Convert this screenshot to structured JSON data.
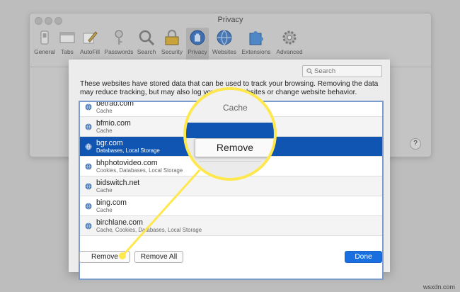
{
  "window": {
    "title": "Privacy"
  },
  "toolbar": {
    "items": [
      {
        "label": "General",
        "icon": "general-switch-icon"
      },
      {
        "label": "Tabs",
        "icon": "tabs-icon"
      },
      {
        "label": "AutoFill",
        "icon": "pencil-icon"
      },
      {
        "label": "Passwords",
        "icon": "key-icon"
      },
      {
        "label": "Search",
        "icon": "magnifier-icon"
      },
      {
        "label": "Security",
        "icon": "lock-icon"
      },
      {
        "label": "Privacy",
        "icon": "hand-icon"
      },
      {
        "label": "Websites",
        "icon": "globe-icon"
      },
      {
        "label": "Extensions",
        "icon": "puzzle-icon"
      },
      {
        "label": "Advanced",
        "icon": "gear-icon"
      }
    ],
    "active": "Privacy"
  },
  "help": {
    "label": "?"
  },
  "sheet": {
    "search_placeholder": "Search",
    "description": "These websites have stored data that can be used to track your browsing. Removing the data may reduce tracking, but may also log you out of websites or change website behavior.",
    "websites": [
      {
        "domain": "betrad.com",
        "data": "Cache"
      },
      {
        "domain": "bfmio.com",
        "data": "Cache"
      },
      {
        "domain": "bgr.com",
        "data": "Databases, Local Storage",
        "selected": true
      },
      {
        "domain": "bhphotovideo.com",
        "data": "Cookies, Databases, Local Storage"
      },
      {
        "domain": "bidswitch.net",
        "data": "Cache"
      },
      {
        "domain": "bing.com",
        "data": "Cache"
      },
      {
        "domain": "birchlane.com",
        "data": "Cache, Cookies, Databases, Local Storage"
      }
    ],
    "buttons": {
      "remove": "Remove",
      "remove_all": "Remove All",
      "done": "Done"
    }
  },
  "callout": {
    "text": "Remove",
    "fragment": "Cache"
  },
  "watermark": "wsxdn.com",
  "colors": {
    "selection": "#0f55b1",
    "accent": "#1a6fe0",
    "highlight": "#ffe84e"
  }
}
